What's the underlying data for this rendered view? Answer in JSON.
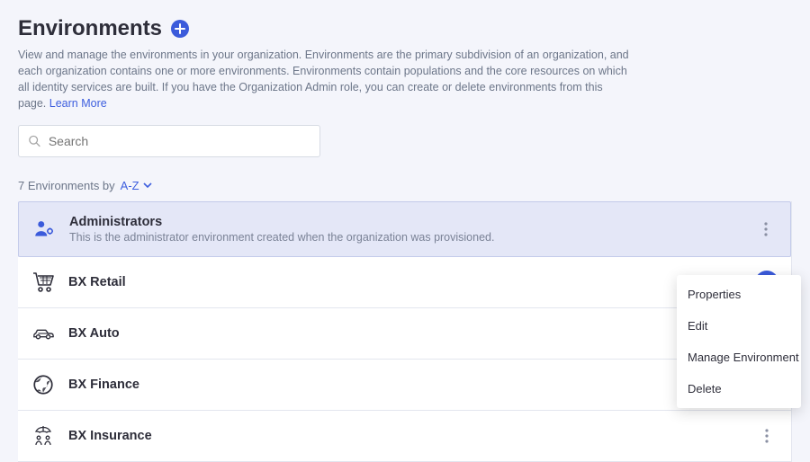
{
  "header": {
    "title": "Environments",
    "description_prefix": "View and manage the environments in your organization. Environments are the primary subdivision of an organization, and each organization contains one or more environments. Environments contain populations and the core resources on which all identity services are built. If you have the Organization Admin role, you can create or delete environments from this page. ",
    "learn_more": "Learn More"
  },
  "search": {
    "placeholder": "Search"
  },
  "count": {
    "text": "7 Environments by",
    "sort": "A-Z"
  },
  "envs": {
    "admins": {
      "name": "Administrators",
      "sub": "This is the administrator environment created when the organization was provisioned."
    },
    "retail": {
      "name": "BX Retail"
    },
    "auto": {
      "name": "BX Auto"
    },
    "finance": {
      "name": "BX Finance"
    },
    "insurance": {
      "name": "BX Insurance"
    }
  },
  "menu": {
    "properties": "Properties",
    "edit": "Edit",
    "manage": "Manage Environment",
    "delete": "Delete"
  }
}
